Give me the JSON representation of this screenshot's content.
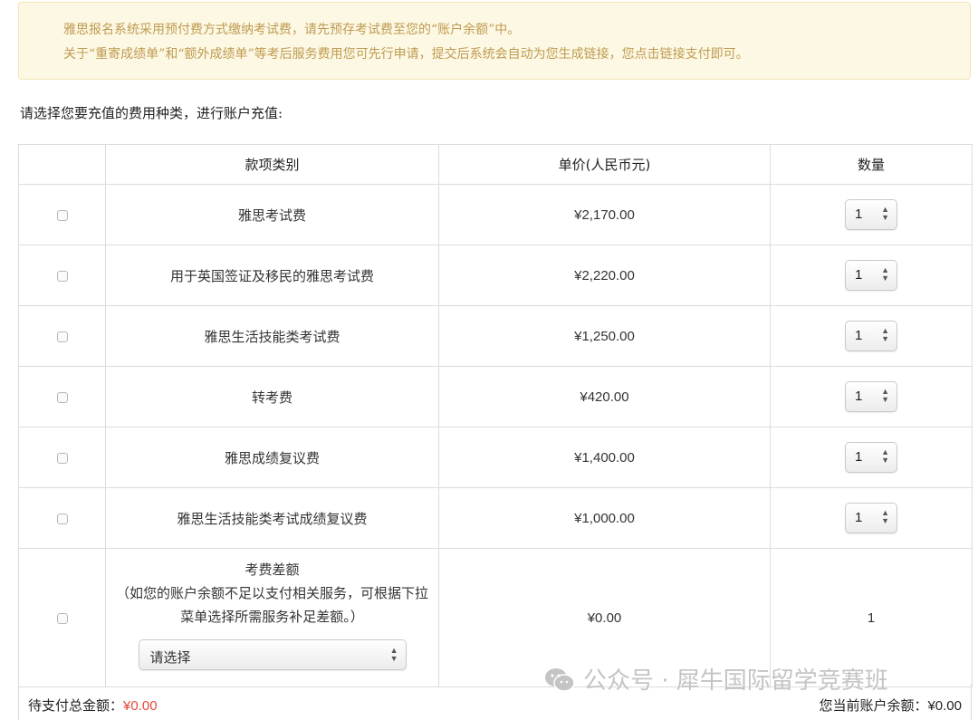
{
  "notice": {
    "line1": "雅思报名系统采用预付费方式缴纳考试费，请先预存考试费至您的“账户余额”中。",
    "line2": "关于“重寄成绩单”和“额外成绩单”等考后服务费用您可先行申请，提交后系统会自动为您生成链接，您点击链接支付即可。"
  },
  "prompt": "请选择您要充值的费用种类，进行账户充值:",
  "table": {
    "headers": {
      "category": "款项类别",
      "price": "单价(人民币元)",
      "quantity": "数量"
    },
    "rows": [
      {
        "name": "雅思考试费",
        "price": "¥2,170.00",
        "qty": "1"
      },
      {
        "name": "用于英国签证及移民的雅思考试费",
        "price": "¥2,220.00",
        "qty": "1"
      },
      {
        "name": "雅思生活技能类考试费",
        "price": "¥1,250.00",
        "qty": "1"
      },
      {
        "name": "转考费",
        "price": "¥420.00",
        "qty": "1"
      },
      {
        "name": "雅思成绩复议费",
        "price": "¥1,400.00",
        "qty": "1"
      },
      {
        "name": "雅思生活技能类考试成绩复议费",
        "price": "¥1,000.00",
        "qty": "1"
      }
    ],
    "difference": {
      "title": "考费差额",
      "note": "（如您的账户余额不足以支付相关服务，可根据下拉菜单选择所需服务补足差额。）",
      "select_value": "请选择",
      "price": "¥0.00",
      "qty": "1"
    }
  },
  "footer": {
    "total_label": "待支付总金额：",
    "total_value": "¥0.00",
    "balance_label": "您当前账户余额：",
    "balance_value": "¥0.00"
  },
  "watermark": "公众号 · 犀牛国际留学竞赛班",
  "colors": {
    "accent_red": "#e4473b",
    "notice_bg": "#fcf8e3",
    "notice_text": "#bf9b52"
  }
}
